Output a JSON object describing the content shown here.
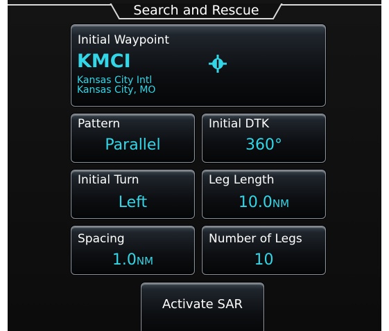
{
  "title": "Search and Rescue",
  "initial_waypoint": {
    "label": "Initial Waypoint",
    "ident": "KMCI",
    "name": "Kansas City Intl",
    "city": "Kansas City, MO",
    "icon": "airport-icon"
  },
  "pattern": {
    "label": "Pattern",
    "value": "Parallel"
  },
  "initial_dtk": {
    "label": "Initial DTK",
    "value": "360°"
  },
  "initial_turn": {
    "label": "Initial Turn",
    "value": "Left"
  },
  "leg_length": {
    "label": "Leg Length",
    "value": "10.0",
    "unit": "NM"
  },
  "spacing": {
    "label": "Spacing",
    "value": "1.0",
    "unit": "NM"
  },
  "number_of_legs": {
    "label": "Number of Legs",
    "value": "10"
  },
  "activate": {
    "label": "Activate SAR"
  },
  "colors": {
    "accent": "#33d6e6",
    "background": "#111111",
    "text": "#ffffff",
    "button_border": "#8a939c"
  }
}
